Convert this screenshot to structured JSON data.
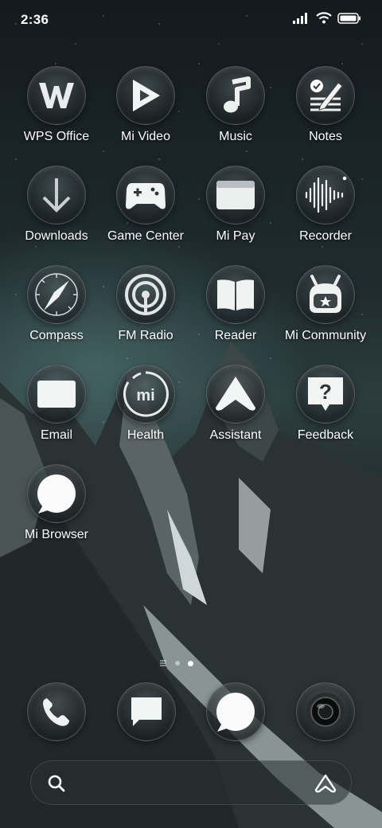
{
  "status_bar": {
    "time": "2:36",
    "icons": [
      "signal-icon",
      "wifi-icon",
      "battery-icon"
    ]
  },
  "apps": [
    {
      "label": "WPS Office",
      "icon": "wps-office-icon"
    },
    {
      "label": "Mi Video",
      "icon": "play-icon"
    },
    {
      "label": "Music",
      "icon": "music-note-icon"
    },
    {
      "label": "Notes",
      "icon": "notes-pen-icon"
    },
    {
      "label": "Downloads",
      "icon": "download-arrow-icon"
    },
    {
      "label": "Game Center",
      "icon": "gamepad-icon"
    },
    {
      "label": "Mi Pay",
      "icon": "wallet-card-icon"
    },
    {
      "label": "Recorder",
      "icon": "waveform-icon"
    },
    {
      "label": "Compass",
      "icon": "compass-icon"
    },
    {
      "label": "FM Radio",
      "icon": "radio-broadcast-icon"
    },
    {
      "label": "Reader",
      "icon": "open-book-icon"
    },
    {
      "label": "Mi Community",
      "icon": "mi-bunny-icon"
    },
    {
      "label": "Email",
      "icon": "envelope-icon"
    },
    {
      "label": "Health",
      "icon": "mi-ring-icon"
    },
    {
      "label": "Assistant",
      "icon": "assistant-a-icon"
    },
    {
      "label": "Feedback",
      "icon": "question-bubble-icon"
    },
    {
      "label": "Mi Browser",
      "icon": "browser-bubble-icon"
    }
  ],
  "page_indicator": {
    "pages": 2,
    "current": 2
  },
  "dock": [
    {
      "icon": "phone-icon"
    },
    {
      "icon": "message-icon"
    },
    {
      "icon": "chat-bubble-icon"
    },
    {
      "icon": "camera-lens-icon"
    }
  ],
  "search_bar": {
    "left_icon": "search-icon",
    "right_icon": "assistant-icon"
  }
}
